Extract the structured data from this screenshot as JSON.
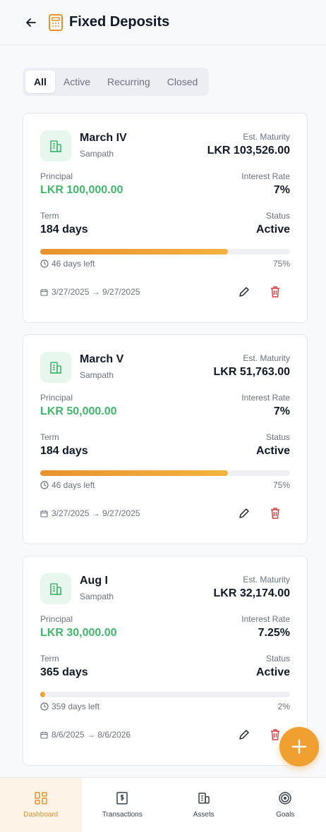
{
  "header": {
    "title": "Fixed Deposits"
  },
  "tabs": [
    {
      "label": "All"
    },
    {
      "label": "Active"
    },
    {
      "label": "Recurring"
    },
    {
      "label": "Closed"
    }
  ],
  "labels": {
    "maturity": "Est. Maturity",
    "principal": "Principal",
    "rate": "Interest Rate",
    "term": "Term",
    "status": "Status"
  },
  "deposits": [
    {
      "name": "March IV",
      "bank": "Sampath",
      "maturity": "LKR 103,526.00",
      "principal": "LKR 100,000.00",
      "rate": "7%",
      "term": "184 days",
      "status": "Active",
      "days_left": "46 days left",
      "progress": "75%",
      "progress_value": 75,
      "dates": "3/27/2025 → 9/27/2025"
    },
    {
      "name": "March V",
      "bank": "Sampath",
      "maturity": "LKR 51,763.00",
      "principal": "LKR 50,000.00",
      "rate": "7%",
      "term": "184 days",
      "status": "Active",
      "days_left": "46 days left",
      "progress": "75%",
      "progress_value": 75,
      "dates": "3/27/2025 → 9/27/2025"
    },
    {
      "name": "Aug I",
      "bank": "Sampath",
      "maturity": "LKR 32,174.00",
      "principal": "LKR 30,000.00",
      "rate": "7.25%",
      "term": "365 days",
      "status": "Active",
      "days_left": "359 days left",
      "progress": "2%",
      "progress_value": 2,
      "dates": "8/6/2025 → 8/6/2026"
    }
  ],
  "nav": [
    {
      "label": "Dashboard",
      "icon": "dashboard-icon",
      "active": true
    },
    {
      "label": "Transactions",
      "icon": "receipt-icon"
    },
    {
      "label": "Assets",
      "icon": "building-icon"
    },
    {
      "label": "Goals",
      "icon": "target-icon"
    }
  ],
  "colors": {
    "accent": "#f0a030",
    "green": "#3fb86a",
    "delete": "#dc3b3b"
  }
}
